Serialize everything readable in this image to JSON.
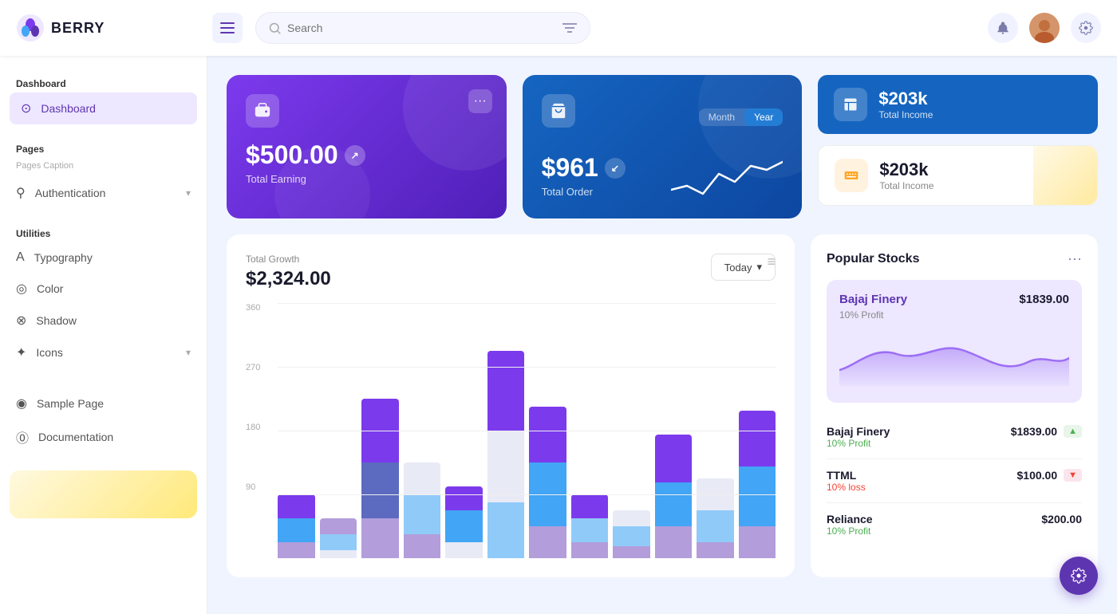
{
  "header": {
    "logo_text": "BERRY",
    "search_placeholder": "Search",
    "menu_label": "menu"
  },
  "sidebar": {
    "dashboard_section": "Dashboard",
    "dashboard_item": "Dashboard",
    "pages_section": "Pages",
    "pages_caption": "Pages Caption",
    "authentication_label": "Authentication",
    "utilities_section": "Utilities",
    "typography_label": "Typography",
    "color_label": "Color",
    "shadow_label": "Shadow",
    "icons_label": "Icons",
    "sample_page_label": "Sample Page",
    "documentation_label": "Documentation"
  },
  "cards": {
    "earning": {
      "amount": "$500.00",
      "label": "Total Earning"
    },
    "order": {
      "amount": "$961",
      "label": "Total Order",
      "toggle_month": "Month",
      "toggle_year": "Year"
    },
    "income1": {
      "amount": "$203k",
      "label": "Total Income"
    },
    "income2": {
      "amount": "$203k",
      "label": "Total Income"
    }
  },
  "growth": {
    "title": "Total Growth",
    "amount": "$2,324.00",
    "btn_label": "Today",
    "y_labels": [
      "360",
      "270",
      "180",
      "90"
    ]
  },
  "stocks": {
    "title": "Popular Stocks",
    "featured_name": "Bajaj Finery",
    "featured_price": "$1839.00",
    "featured_sub": "10% Profit",
    "items": [
      {
        "name": "Bajaj Finery",
        "price": "$1839.00",
        "change": "10% Profit",
        "trend": "up"
      },
      {
        "name": "TTML",
        "price": "$100.00",
        "change": "10% loss",
        "trend": "down"
      },
      {
        "name": "Reliance",
        "price": "$200.00",
        "change": "10% Profit",
        "trend": "up"
      }
    ]
  },
  "fab": {
    "icon": "⚙"
  }
}
